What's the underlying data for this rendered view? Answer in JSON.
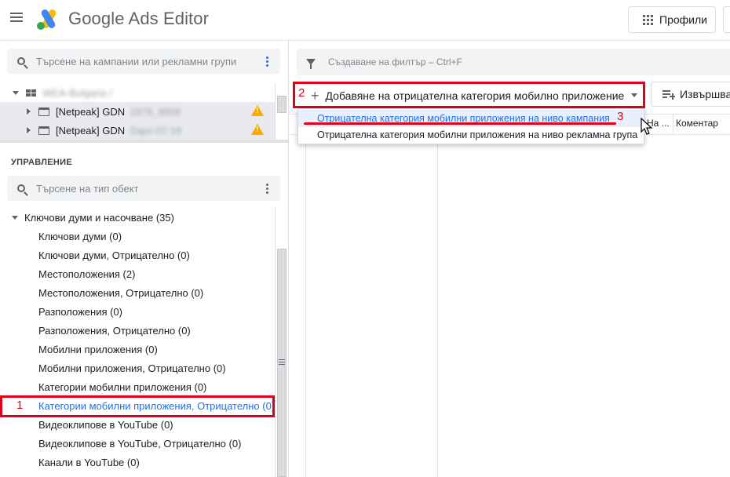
{
  "header": {
    "app_title": "Google Ads Editor",
    "profiles_label": "Профили",
    "menu_icon": "hamburger-menu-icon",
    "logo_colors": [
      "#fbbc04",
      "#4285f4",
      "#34a853"
    ]
  },
  "left": {
    "campaign_search_placeholder": "Търсене на кампании или рекламни групи",
    "account_name": "WEA-Bulgaria /",
    "campaigns": [
      {
        "label": "[Netpeak] GDN",
        "suffix": "1978_9858",
        "warning": true
      },
      {
        "label": "[Netpeak] GDN",
        "suffix": "Zapo 07.19",
        "warning": true
      }
    ],
    "section_title": "УПРАВЛЕНИЕ",
    "type_search_placeholder": "Търсене на тип обект",
    "tree": [
      {
        "label": "Ключови думи и насочване (35)",
        "level": 0
      },
      {
        "label": "Ключови думи (0)",
        "level": 1
      },
      {
        "label": "Ключови думи, Отрицателно (0)",
        "level": 1
      },
      {
        "label": "Местоположения (2)",
        "level": 1
      },
      {
        "label": "Местоположения, Отрицателно (0)",
        "level": 1
      },
      {
        "label": "Разположения (0)",
        "level": 1
      },
      {
        "label": "Разположения, Отрицателно (0)",
        "level": 1
      },
      {
        "label": "Мобилни приложения (0)",
        "level": 1
      },
      {
        "label": "Мобилни приложения, Отрицателно (0)",
        "level": 1
      },
      {
        "label": "Категории мобилни приложения (0)",
        "level": 1
      },
      {
        "label": "Категории мобилни приложения, Отрицателно (0)",
        "level": 1,
        "selected": true
      },
      {
        "label": "Видеоклипове в YouTube (0)",
        "level": 1
      },
      {
        "label": "Видеоклипове в YouTube, Отрицателно (0)",
        "level": 1
      },
      {
        "label": "Канали в YouTube (0)",
        "level": 1
      }
    ]
  },
  "right": {
    "filter_placeholder": "Създаване на филтър – Ctrl+F",
    "add_button_label": "Добавяне на отрицателна категория мобилно приложение",
    "revert_label": "Извършва",
    "dropdown": [
      "Отрицателна категория мобилни приложения на ниво кампания",
      "Отрицателна категория мобилни приложения на ниво рекламна група"
    ],
    "columns": [
      "На ...",
      "Коментар"
    ]
  },
  "annotations": [
    "1",
    "2",
    "3"
  ],
  "colors": {
    "accent": "#1a73e8",
    "annotation": "#e0001b",
    "warning": "#f9ab00"
  }
}
